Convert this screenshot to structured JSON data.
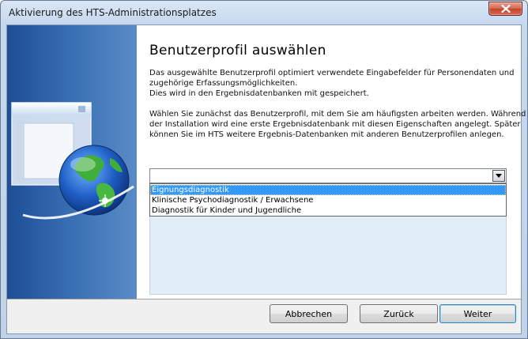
{
  "window": {
    "title": "Aktivierung des HTS-Administrationsplatzes",
    "close_icon": "close-icon"
  },
  "banner": {
    "icon": "globe-window-icon"
  },
  "main": {
    "heading": "Benutzerprofil auswählen",
    "paragraph1": [
      "Das ausgewählte Benutzerprofil optimiert verwendete Eingabefelder für Personendaten und",
      "zugehörige Erfassungsmöglichkeiten.",
      "Dies wird in den Ergebnisdatenbanken mit gespeichert."
    ],
    "paragraph2": [
      "Wählen Sie zunächst das Benutzerprofil, mit dem Sie am häufigsten arbeiten werden. Während",
      "der Installation wird eine erste Ergebnisdatenbank mit diesen Eigenschaften angelegt. Später",
      "können Sie im HTS weitere Ergebnis-Datenbanken mit anderen Benutzerprofilen anlegen."
    ],
    "combo": {
      "value": "",
      "arrow_icon": "chevron-down-icon",
      "options": [
        "Eignungsdiagnostik",
        "Klinische Psychodiagnostik / Erwachsene",
        "Diagnostik für Kinder und Jugendliche"
      ],
      "highlighted_index": 0
    }
  },
  "buttons": {
    "cancel": "Abbrechen",
    "back": "Zurück",
    "next": "Weiter"
  }
}
